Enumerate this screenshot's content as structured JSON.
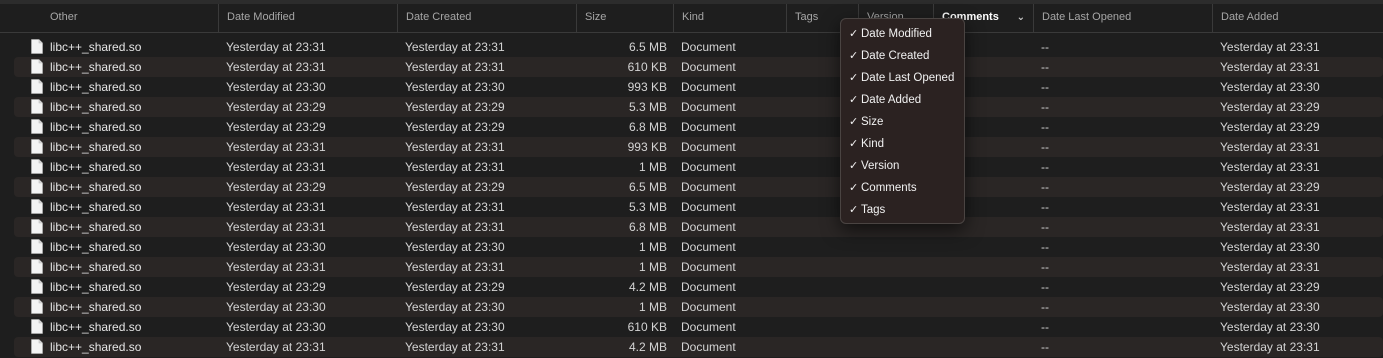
{
  "header": {
    "columns": [
      {
        "key": "other",
        "label": "Other"
      },
      {
        "key": "date_modified",
        "label": "Date Modified"
      },
      {
        "key": "date_created",
        "label": "Date Created"
      },
      {
        "key": "size",
        "label": "Size"
      },
      {
        "key": "kind",
        "label": "Kind"
      },
      {
        "key": "tags",
        "label": "Tags"
      },
      {
        "key": "version",
        "label": "Version"
      },
      {
        "key": "comments",
        "label": "Comments"
      },
      {
        "key": "date_last_opened",
        "label": "Date Last Opened"
      },
      {
        "key": "date_added",
        "label": "Date Added"
      }
    ],
    "sort_indicator": "⌄"
  },
  "rows": [
    {
      "name": "libc++_shared.so",
      "modified": "Yesterday at 23:31",
      "created": "Yesterday at 23:31",
      "size": "6.5 MB",
      "kind": "Document",
      "opened": "--",
      "added": "Yesterday at 23:31"
    },
    {
      "name": "libc++_shared.so",
      "modified": "Yesterday at 23:31",
      "created": "Yesterday at 23:31",
      "size": "610 KB",
      "kind": "Document",
      "opened": "--",
      "added": "Yesterday at 23:31"
    },
    {
      "name": "libc++_shared.so",
      "modified": "Yesterday at 23:30",
      "created": "Yesterday at 23:30",
      "size": "993 KB",
      "kind": "Document",
      "opened": "--",
      "added": "Yesterday at 23:30"
    },
    {
      "name": "libc++_shared.so",
      "modified": "Yesterday at 23:29",
      "created": "Yesterday at 23:29",
      "size": "5.3 MB",
      "kind": "Document",
      "opened": "--",
      "added": "Yesterday at 23:29"
    },
    {
      "name": "libc++_shared.so",
      "modified": "Yesterday at 23:29",
      "created": "Yesterday at 23:29",
      "size": "6.8 MB",
      "kind": "Document",
      "opened": "--",
      "added": "Yesterday at 23:29"
    },
    {
      "name": "libc++_shared.so",
      "modified": "Yesterday at 23:31",
      "created": "Yesterday at 23:31",
      "size": "993 KB",
      "kind": "Document",
      "opened": "--",
      "added": "Yesterday at 23:31"
    },
    {
      "name": "libc++_shared.so",
      "modified": "Yesterday at 23:31",
      "created": "Yesterday at 23:31",
      "size": "1 MB",
      "kind": "Document",
      "opened": "--",
      "added": "Yesterday at 23:31"
    },
    {
      "name": "libc++_shared.so",
      "modified": "Yesterday at 23:29",
      "created": "Yesterday at 23:29",
      "size": "6.5 MB",
      "kind": "Document",
      "opened": "--",
      "added": "Yesterday at 23:29"
    },
    {
      "name": "libc++_shared.so",
      "modified": "Yesterday at 23:31",
      "created": "Yesterday at 23:31",
      "size": "5.3 MB",
      "kind": "Document",
      "opened": "--",
      "added": "Yesterday at 23:31"
    },
    {
      "name": "libc++_shared.so",
      "modified": "Yesterday at 23:31",
      "created": "Yesterday at 23:31",
      "size": "6.8 MB",
      "kind": "Document",
      "opened": "--",
      "added": "Yesterday at 23:31"
    },
    {
      "name": "libc++_shared.so",
      "modified": "Yesterday at 23:30",
      "created": "Yesterday at 23:30",
      "size": "1 MB",
      "kind": "Document",
      "opened": "--",
      "added": "Yesterday at 23:30"
    },
    {
      "name": "libc++_shared.so",
      "modified": "Yesterday at 23:31",
      "created": "Yesterday at 23:31",
      "size": "1 MB",
      "kind": "Document",
      "opened": "--",
      "added": "Yesterday at 23:31"
    },
    {
      "name": "libc++_shared.so",
      "modified": "Yesterday at 23:29",
      "created": "Yesterday at 23:29",
      "size": "4.2 MB",
      "kind": "Document",
      "opened": "--",
      "added": "Yesterday at 23:29"
    },
    {
      "name": "libc++_shared.so",
      "modified": "Yesterday at 23:30",
      "created": "Yesterday at 23:30",
      "size": "1 MB",
      "kind": "Document",
      "opened": "--",
      "added": "Yesterday at 23:30"
    },
    {
      "name": "libc++_shared.so",
      "modified": "Yesterday at 23:30",
      "created": "Yesterday at 23:30",
      "size": "610 KB",
      "kind": "Document",
      "opened": "--",
      "added": "Yesterday at 23:30"
    },
    {
      "name": "libc++_shared.so",
      "modified": "Yesterday at 23:31",
      "created": "Yesterday at 23:31",
      "size": "4.2 MB",
      "kind": "Document",
      "opened": "--",
      "added": "Yesterday at 23:31"
    }
  ],
  "row_icon": "document-icon",
  "column_menu": {
    "check_glyph": "✓",
    "items": [
      {
        "label": "Date Modified",
        "checked": true
      },
      {
        "label": "Date Created",
        "checked": true
      },
      {
        "label": "Date Last Opened",
        "checked": true
      },
      {
        "label": "Date Added",
        "checked": true
      },
      {
        "label": "Size",
        "checked": true
      },
      {
        "label": "Kind",
        "checked": true
      },
      {
        "label": "Version",
        "checked": true
      },
      {
        "label": "Comments",
        "checked": true
      },
      {
        "label": "Tags",
        "checked": true
      }
    ]
  },
  "colors": {
    "background": "#1e1e1e",
    "alt_row": "#2a2625",
    "menu_background": "#2b2221",
    "header_text": "#a6a6a6",
    "text": "#d4d4d4"
  }
}
